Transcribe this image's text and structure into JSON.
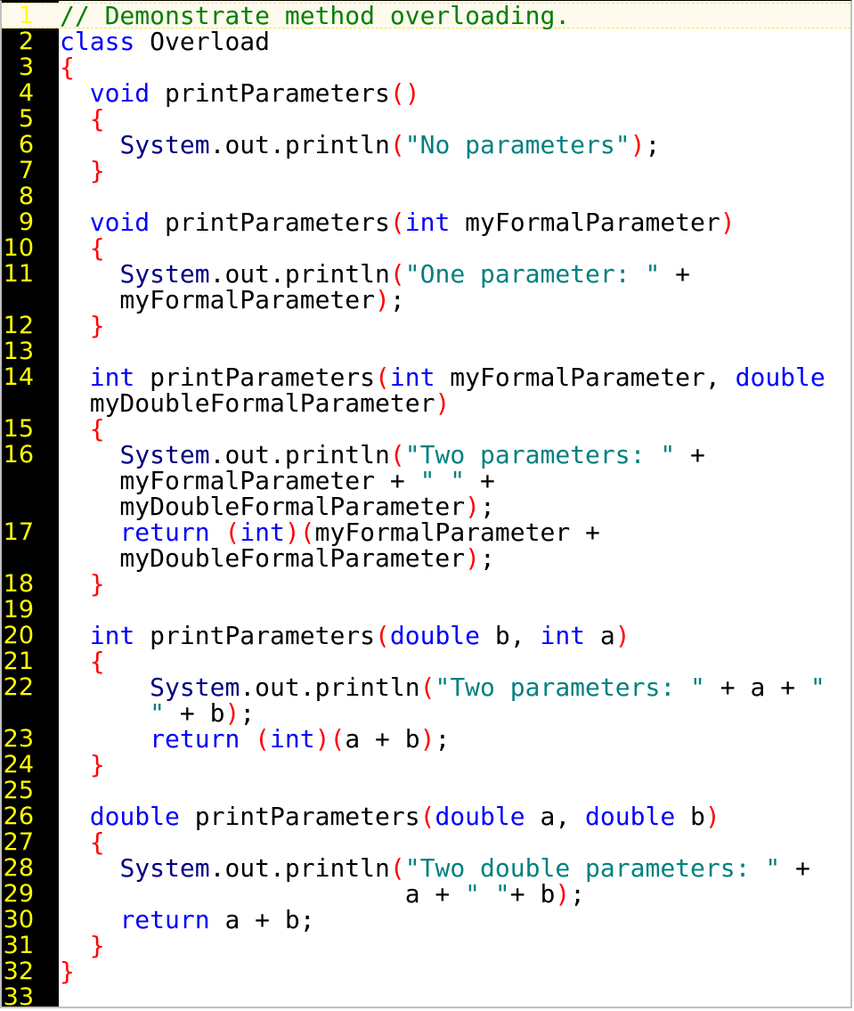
{
  "editor": {
    "current_line": 1,
    "colors": {
      "gutter_bg": "#000000",
      "line_number": "#ffff00",
      "keyword": "#0000ff",
      "system_class": "#000080",
      "string": "#008080",
      "bracket": "#ff0000",
      "comment": "#008000",
      "current_line_bg": "#fffaee"
    },
    "rows": [
      {
        "num": "1",
        "tokens": [
          [
            "com",
            "// Demonstrate method overloading."
          ]
        ]
      },
      {
        "num": "2",
        "tokens": [
          [
            "kw",
            "class"
          ],
          [
            "pl",
            " Overload"
          ]
        ]
      },
      {
        "num": "3",
        "tokens": [
          [
            "par",
            "{"
          ]
        ]
      },
      {
        "num": "4",
        "tokens": [
          [
            "pl",
            "  "
          ],
          [
            "kw",
            "void"
          ],
          [
            "pl",
            " printParameters"
          ],
          [
            "par",
            "()"
          ]
        ]
      },
      {
        "num": "5",
        "tokens": [
          [
            "pl",
            "  "
          ],
          [
            "par",
            "{"
          ]
        ]
      },
      {
        "num": "6",
        "tokens": [
          [
            "pl",
            "    "
          ],
          [
            "sys",
            "System"
          ],
          [
            "pl",
            ".out.println"
          ],
          [
            "par",
            "("
          ],
          [
            "str",
            "\"No parameters\""
          ],
          [
            "par",
            ")"
          ],
          [
            "pl",
            ";"
          ]
        ]
      },
      {
        "num": "7",
        "tokens": [
          [
            "pl",
            "  "
          ],
          [
            "par",
            "}"
          ]
        ]
      },
      {
        "num": "8",
        "tokens": []
      },
      {
        "num": "9",
        "tokens": [
          [
            "pl",
            "  "
          ],
          [
            "kw",
            "void"
          ],
          [
            "pl",
            " printParameters"
          ],
          [
            "par",
            "("
          ],
          [
            "kw",
            "int"
          ],
          [
            "pl",
            " myFormalParameter"
          ],
          [
            "par",
            ")"
          ]
        ]
      },
      {
        "num": "10",
        "tokens": [
          [
            "pl",
            "  "
          ],
          [
            "par",
            "{"
          ]
        ]
      },
      {
        "num": "11",
        "tokens": [
          [
            "pl",
            "    "
          ],
          [
            "sys",
            "System"
          ],
          [
            "pl",
            ".out.println"
          ],
          [
            "par",
            "("
          ],
          [
            "str",
            "\"One parameter: \""
          ],
          [
            "pl",
            " +"
          ]
        ]
      },
      {
        "num": "",
        "tokens": [
          [
            "pl",
            "    myFormalParameter"
          ],
          [
            "par",
            ")"
          ],
          [
            "pl",
            ";"
          ]
        ]
      },
      {
        "num": "12",
        "tokens": [
          [
            "pl",
            "  "
          ],
          [
            "par",
            "}"
          ]
        ]
      },
      {
        "num": "13",
        "tokens": []
      },
      {
        "num": "14",
        "tokens": [
          [
            "pl",
            "  "
          ],
          [
            "kw",
            "int"
          ],
          [
            "pl",
            " printParameters"
          ],
          [
            "par",
            "("
          ],
          [
            "kw",
            "int"
          ],
          [
            "pl",
            " myFormalParameter, "
          ],
          [
            "kw",
            "double"
          ]
        ]
      },
      {
        "num": "",
        "tokens": [
          [
            "pl",
            "  myDoubleFormalParameter"
          ],
          [
            "par",
            ")"
          ]
        ]
      },
      {
        "num": "15",
        "tokens": [
          [
            "pl",
            "  "
          ],
          [
            "par",
            "{"
          ]
        ]
      },
      {
        "num": "16",
        "tokens": [
          [
            "pl",
            "    "
          ],
          [
            "sys",
            "System"
          ],
          [
            "pl",
            ".out.println"
          ],
          [
            "par",
            "("
          ],
          [
            "str",
            "\"Two parameters: \""
          ],
          [
            "pl",
            " +"
          ]
        ]
      },
      {
        "num": "",
        "tokens": [
          [
            "pl",
            "    myFormalParameter + "
          ],
          [
            "str",
            "\" \""
          ],
          [
            "pl",
            " +"
          ]
        ]
      },
      {
        "num": "",
        "tokens": [
          [
            "pl",
            "    myDoubleFormalParameter"
          ],
          [
            "par",
            ")"
          ],
          [
            "pl",
            ";"
          ]
        ]
      },
      {
        "num": "17",
        "tokens": [
          [
            "pl",
            "    "
          ],
          [
            "kw",
            "return"
          ],
          [
            "pl",
            " "
          ],
          [
            "par",
            "("
          ],
          [
            "kw",
            "int"
          ],
          [
            "par",
            ")("
          ],
          [
            "pl",
            "myFormalParameter +"
          ]
        ]
      },
      {
        "num": "",
        "tokens": [
          [
            "pl",
            "    myDoubleFormalParameter"
          ],
          [
            "par",
            ")"
          ],
          [
            "pl",
            ";"
          ]
        ]
      },
      {
        "num": "18",
        "tokens": [
          [
            "pl",
            "  "
          ],
          [
            "par",
            "}"
          ]
        ]
      },
      {
        "num": "19",
        "tokens": []
      },
      {
        "num": "20",
        "tokens": [
          [
            "pl",
            "  "
          ],
          [
            "kw",
            "int"
          ],
          [
            "pl",
            " printParameters"
          ],
          [
            "par",
            "("
          ],
          [
            "kw",
            "double"
          ],
          [
            "pl",
            " b, "
          ],
          [
            "kw",
            "int"
          ],
          [
            "pl",
            " a"
          ],
          [
            "par",
            ")"
          ]
        ]
      },
      {
        "num": "21",
        "tokens": [
          [
            "pl",
            "  "
          ],
          [
            "par",
            "{"
          ]
        ]
      },
      {
        "num": "22",
        "tokens": [
          [
            "pl",
            "      "
          ],
          [
            "sys",
            "System"
          ],
          [
            "pl",
            ".out.println"
          ],
          [
            "par",
            "("
          ],
          [
            "str",
            "\"Two parameters: \""
          ],
          [
            "pl",
            " + a + "
          ],
          [
            "str",
            "\""
          ]
        ]
      },
      {
        "num": "",
        "tokens": [
          [
            "pl",
            "      "
          ],
          [
            "str",
            "\""
          ],
          [
            "pl",
            " + b"
          ],
          [
            "par",
            ")"
          ],
          [
            "pl",
            ";"
          ]
        ]
      },
      {
        "num": "23",
        "tokens": [
          [
            "pl",
            "      "
          ],
          [
            "kw",
            "return"
          ],
          [
            "pl",
            " "
          ],
          [
            "par",
            "("
          ],
          [
            "kw",
            "int"
          ],
          [
            "par",
            ")("
          ],
          [
            "pl",
            "a + b"
          ],
          [
            "par",
            ")"
          ],
          [
            "pl",
            ";"
          ]
        ]
      },
      {
        "num": "24",
        "tokens": [
          [
            "pl",
            "  "
          ],
          [
            "par",
            "}"
          ]
        ]
      },
      {
        "num": "25",
        "tokens": []
      },
      {
        "num": "26",
        "tokens": [
          [
            "pl",
            "  "
          ],
          [
            "kw",
            "double"
          ],
          [
            "pl",
            " printParameters"
          ],
          [
            "par",
            "("
          ],
          [
            "kw",
            "double"
          ],
          [
            "pl",
            " a, "
          ],
          [
            "kw",
            "double"
          ],
          [
            "pl",
            " b"
          ],
          [
            "par",
            ")"
          ]
        ]
      },
      {
        "num": "27",
        "tokens": [
          [
            "pl",
            "  "
          ],
          [
            "par",
            "{"
          ]
        ]
      },
      {
        "num": "28",
        "tokens": [
          [
            "pl",
            "    "
          ],
          [
            "sys",
            "System"
          ],
          [
            "pl",
            ".out.println"
          ],
          [
            "par",
            "("
          ],
          [
            "str",
            "\"Two double parameters: \""
          ],
          [
            "pl",
            " +"
          ]
        ]
      },
      {
        "num": "29",
        "tokens": [
          [
            "pl",
            "                       a + "
          ],
          [
            "str",
            "\" \""
          ],
          [
            "pl",
            "+ b"
          ],
          [
            "par",
            ")"
          ],
          [
            "pl",
            ";"
          ]
        ]
      },
      {
        "num": "30",
        "tokens": [
          [
            "pl",
            "    "
          ],
          [
            "kw",
            "return"
          ],
          [
            "pl",
            " a + b;"
          ]
        ]
      },
      {
        "num": "31",
        "tokens": [
          [
            "pl",
            "  "
          ],
          [
            "par",
            "}"
          ]
        ]
      },
      {
        "num": "32",
        "tokens": [
          [
            "par",
            "}"
          ]
        ]
      },
      {
        "num": "33",
        "tokens": []
      }
    ]
  }
}
